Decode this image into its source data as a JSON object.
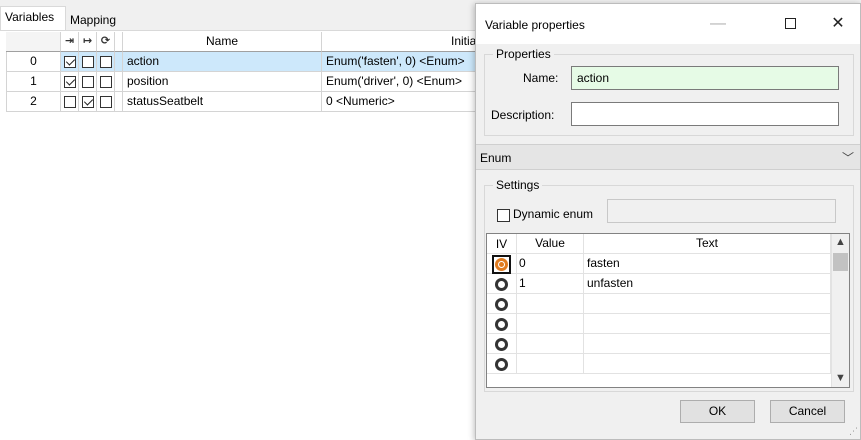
{
  "tabs": {
    "variables": "Variables",
    "mapping": "Mapping"
  },
  "grid": {
    "headers": {
      "name": "Name",
      "initial": "Initial"
    },
    "header_icons": [
      "input-arrow-icon",
      "output-arrow-icon",
      "sync-icon"
    ],
    "rows": [
      {
        "index": "0",
        "flags": [
          true,
          false,
          false
        ],
        "name": "action",
        "initial": "Enum('fasten', 0) <Enum>",
        "selected": true
      },
      {
        "index": "1",
        "flags": [
          true,
          false,
          false
        ],
        "name": "position",
        "initial": "Enum('driver', 0) <Enum>",
        "selected": false
      },
      {
        "index": "2",
        "flags": [
          false,
          true,
          false
        ],
        "name": "statusSeatbelt",
        "initial": "0 <Numeric>",
        "selected": false
      }
    ]
  },
  "dialog": {
    "title": "Variable properties",
    "controls": {
      "minimize": "—",
      "close": "✕"
    },
    "properties_legend": "Properties",
    "name_label": "Name:",
    "name_value": "action",
    "description_label": "Description:",
    "description_value": "",
    "type_value": "Enum",
    "settings_legend": "Settings",
    "dynamic_enum_label": "Dynamic enum",
    "dynamic_enum_checked": false,
    "enum_table": {
      "headers": {
        "iv": "IV",
        "value": "Value",
        "text": "Text"
      },
      "rows": [
        {
          "value": "0",
          "text": "fasten",
          "initial": true
        },
        {
          "value": "1",
          "text": "unfasten",
          "initial": false
        },
        {
          "value": "",
          "text": "",
          "initial": false
        },
        {
          "value": "",
          "text": "",
          "initial": false
        },
        {
          "value": "",
          "text": "",
          "initial": false
        },
        {
          "value": "",
          "text": "",
          "initial": false
        }
      ]
    },
    "ok_label": "OK",
    "cancel_label": "Cancel"
  },
  "colors": {
    "selection": "#cde8fb",
    "name_field": "#e6fbe6",
    "radio_selected": "#e07b1f"
  }
}
